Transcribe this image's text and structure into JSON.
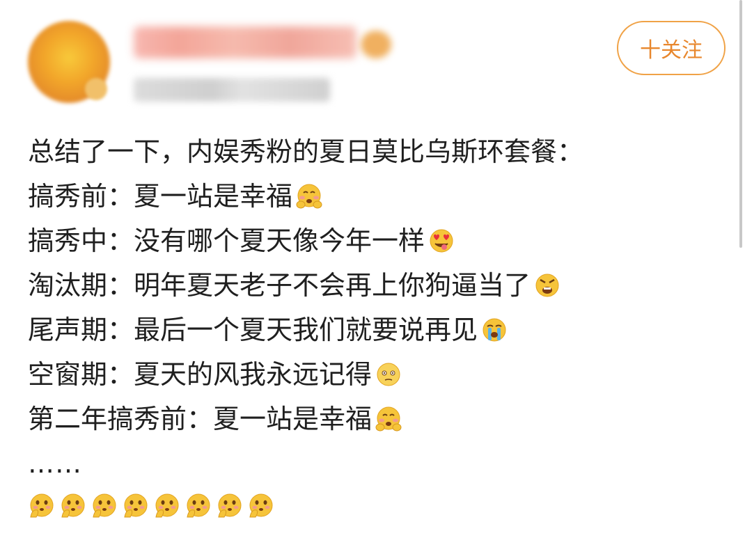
{
  "header": {
    "follow_label": "十关注"
  },
  "post": {
    "lines": [
      {
        "text": "总结了一下，内娱秀粉的夏日莫比乌斯环套餐：",
        "emoji": ""
      },
      {
        "text": "搞秀前：夏一站是幸福",
        "emoji": "blush-hands-emoji"
      },
      {
        "text": "搞秀中：没有哪个夏天像今年一样",
        "emoji": "heart-eyes-tongue-emoji"
      },
      {
        "text": "淘汰期：明年夏天老子不会再上你狗逼当了",
        "emoji": "angry-shouting-emoji"
      },
      {
        "text": "尾声期：最后一个夏天我们就要说再见",
        "emoji": "crying-emoji"
      },
      {
        "text": "空窗期：夏天的风我永远记得",
        "emoji": "dazed-emoji"
      },
      {
        "text": "第二年搞秀前：夏一站是幸福",
        "emoji": "blush-hands-emoji"
      }
    ],
    "ellipsis": "……",
    "trailing_emoji_count": 8,
    "trailing_emoji": "thinking-hand-emoji"
  },
  "colors": {
    "follow_accent": "#e8872d",
    "emoji_face": "#f6c43a"
  }
}
